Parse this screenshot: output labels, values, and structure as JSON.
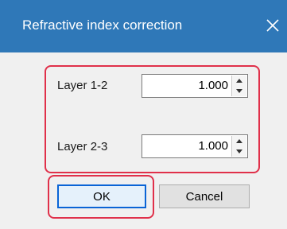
{
  "dialog": {
    "title": "Refractive index correction",
    "close_icon": "close-icon"
  },
  "layers": [
    {
      "label": "Layer 1-2",
      "value": "1.000"
    },
    {
      "label": "Layer 2-3",
      "value": "1.000"
    }
  ],
  "buttons": {
    "ok": "OK",
    "cancel": "Cancel"
  },
  "colors": {
    "titlebar": "#2f78b8",
    "highlight": "#e0304a",
    "default_button_border": "#0a64d6"
  }
}
